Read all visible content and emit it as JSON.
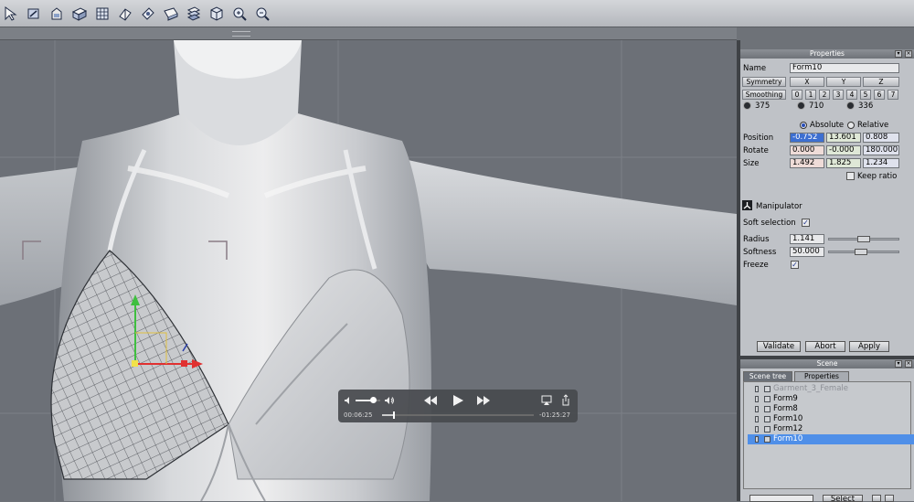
{
  "toolbar": {
    "icons": [
      "select-tool-icon",
      "rotate-tool-icon",
      "paint-bucket-icon",
      "box-tool-icon",
      "mesh-tool-icon",
      "layer-icon",
      "sculpt-tool-icon",
      "deform-tool-icon",
      "stack-icon",
      "cube-icon",
      "zoom-in-icon",
      "zoom-out-icon"
    ]
  },
  "player": {
    "elapsed": "00:06:25",
    "remaining": "-01:25:27",
    "volume": 0.7,
    "progress": 0.07
  },
  "properties": {
    "title": "Properties",
    "name_label": "Name",
    "name_value": "Form10",
    "symmetry_label": "Symmetry",
    "axes": [
      "X",
      "Y",
      "Z"
    ],
    "smoothing_label": "Smoothing",
    "smoothing_levels": [
      "0",
      "1",
      "2",
      "3",
      "4",
      "5",
      "6",
      "7"
    ],
    "counts": [
      "375",
      "710",
      "336"
    ],
    "absolute_label": "Absolute",
    "relative_label": "Relative",
    "position_label": "Position",
    "position": [
      "-0.752",
      "13.601",
      "0.808"
    ],
    "rotate_label": "Rotate",
    "rotate": [
      "0.000",
      "-0.000",
      "180.000"
    ],
    "size_label": "Size",
    "size": [
      "1.492",
      "1.825",
      "1.234"
    ],
    "keep_ratio_label": "Keep ratio",
    "manipulator_label": "Manipulator",
    "soft_selection_label": "Soft selection",
    "radius_label": "Radius",
    "radius_value": "1.141",
    "softness_label": "Softness",
    "softness_value": "50.000",
    "freeze_label": "Freeze",
    "validate_label": "Validate",
    "abort_label": "Abort",
    "apply_label": "Apply"
  },
  "scene": {
    "title": "Scene",
    "tabs": [
      "Scene tree",
      "Properties"
    ],
    "items": [
      "Garment_3_Female",
      "Form9",
      "Form8",
      "Form10",
      "Form12",
      "Form10"
    ],
    "select_label": "Select"
  }
}
